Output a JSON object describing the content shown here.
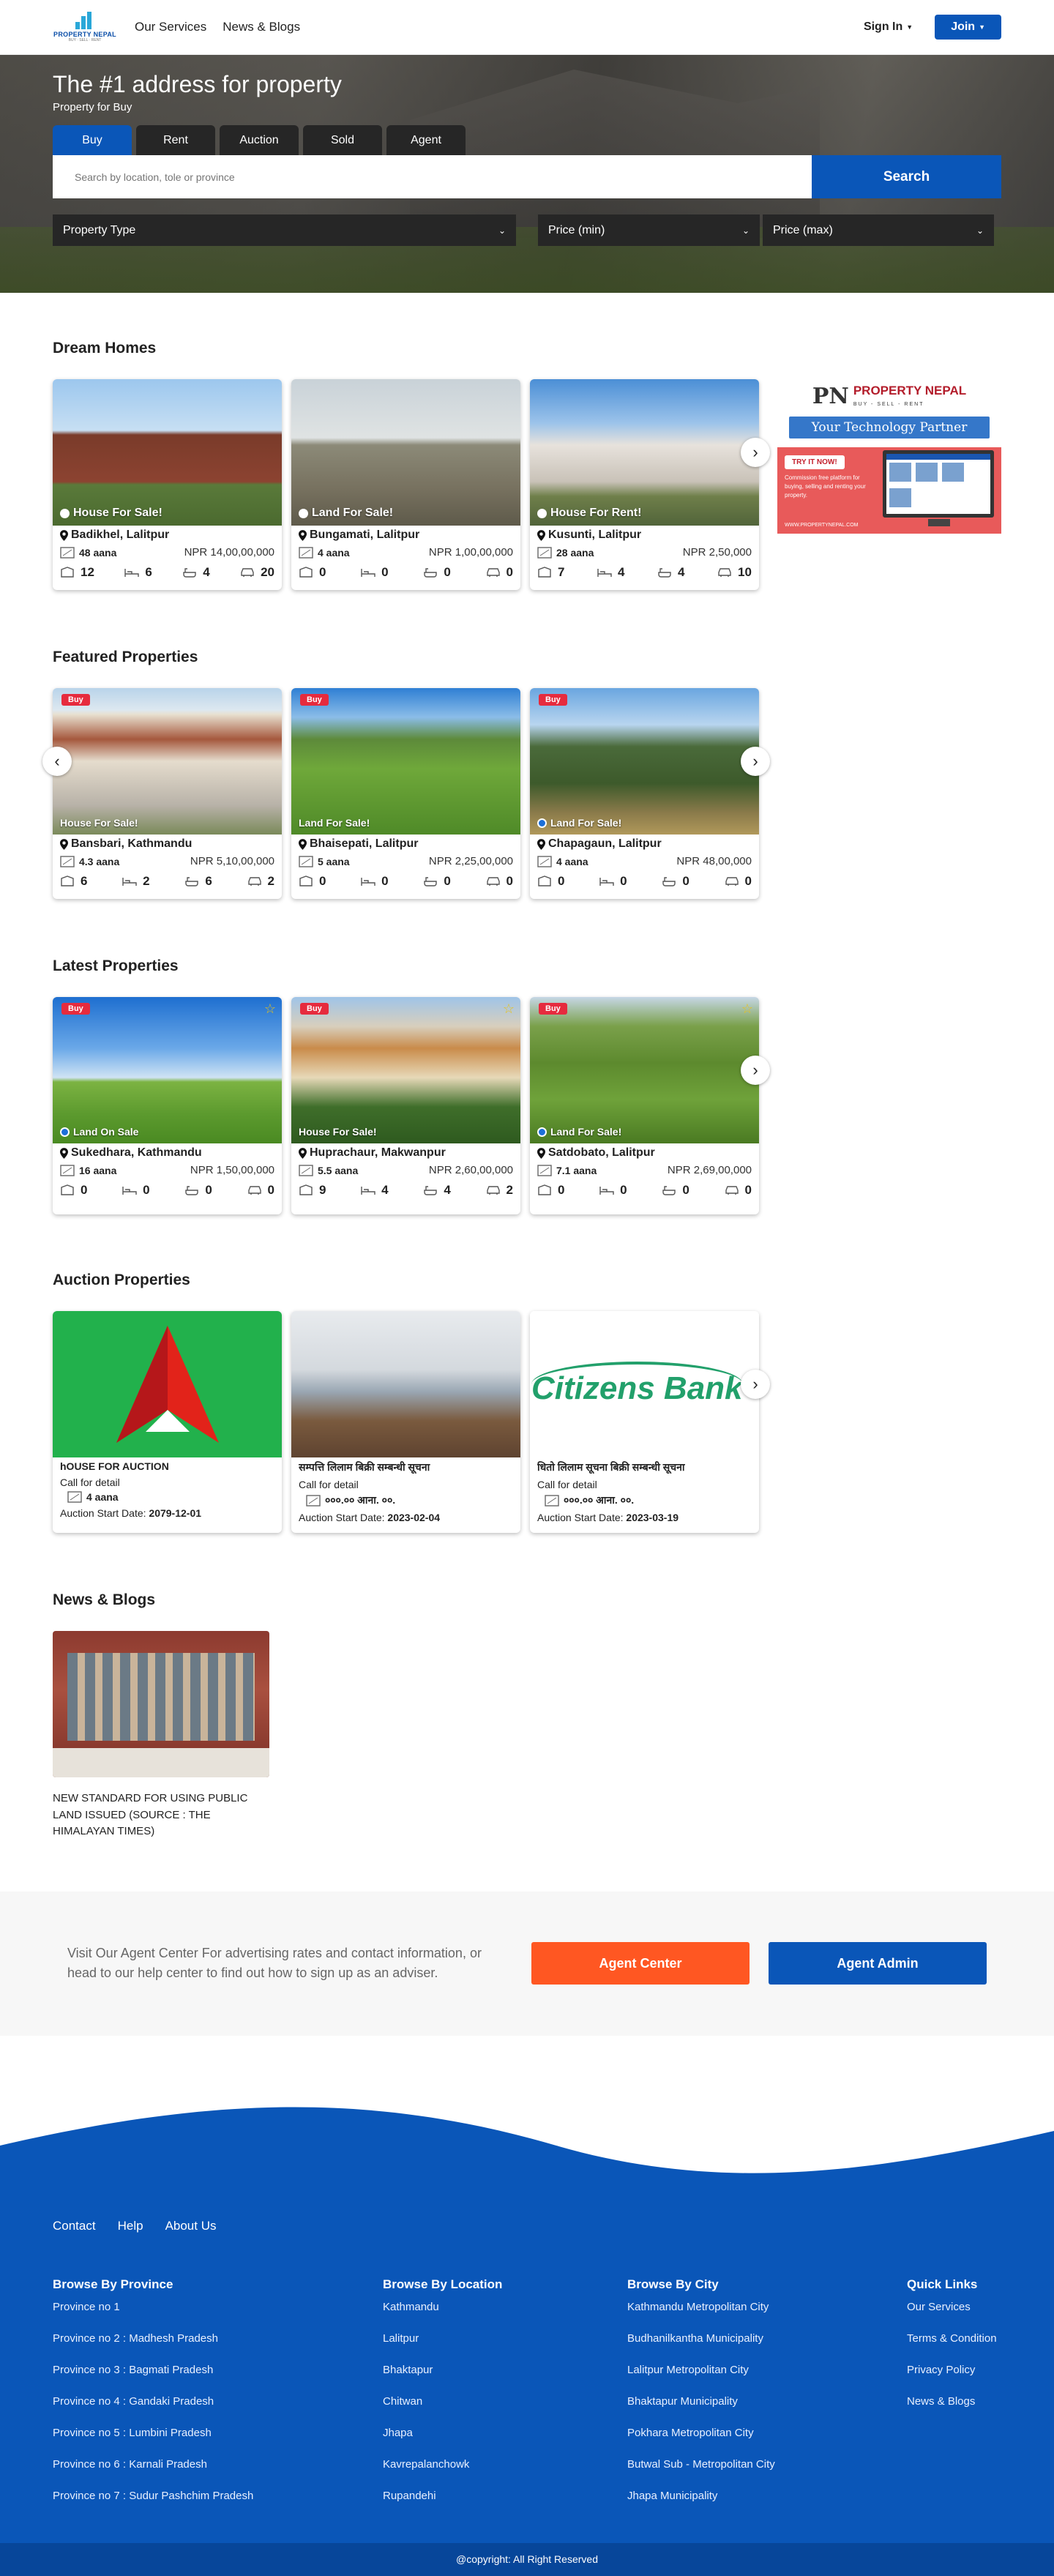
{
  "header": {
    "logo_text": "PROPERTY NEPAL",
    "logo_sub": "BUY · SELL · RENT",
    "nav": [
      "Our Services",
      "News & Blogs"
    ],
    "signin": "Sign In",
    "join": "Join"
  },
  "hero": {
    "title": "The #1 address for property",
    "subtitle": "Property for Buy",
    "tabs": [
      "Buy",
      "Rent",
      "Auction",
      "Sold",
      "Agent"
    ],
    "active_tab": "Buy",
    "search_placeholder": "Search by location, tole or province",
    "search_button": "Search",
    "filter_type": "Property Type",
    "filter_min": "Price (min)",
    "filter_max": "Price (max)"
  },
  "dream": {
    "title": "Dream Homes",
    "cards": [
      {
        "label": "House For Sale!",
        "location": "Badikhel, Lalitpur",
        "area": "48 aana",
        "price": "NPR 14,00,00,000",
        "stats": [
          "12",
          "6",
          "4",
          "20"
        ]
      },
      {
        "label": "Land For Sale!",
        "location": "Bungamati, Lalitpur",
        "area": "4 aana",
        "price": "NPR 1,00,00,000",
        "stats": [
          "0",
          "0",
          "0",
          "0"
        ]
      },
      {
        "label": "House For Rent!",
        "location": "Kusunti, Lalitpur",
        "area": "28 aana",
        "price": "NPR 2,50,000",
        "stats": [
          "7",
          "4",
          "4",
          "10"
        ]
      }
    ]
  },
  "ad": {
    "brand": "PROPERTY NEPAL",
    "brand_sub": "BUY - SELL - RENT",
    "pill": "Your Technology Partner",
    "try": "TRY IT NOW!",
    "copy": "Commission free platform for buying, selling and renting your property.",
    "url": "WWW.PROPERTYNEPAL.COM"
  },
  "featured": {
    "title": "Featured Properties",
    "cards": [
      {
        "tag": "Buy",
        "label": "House For Sale!",
        "location": "Bansbari, Kathmandu",
        "area": "4.3 aana",
        "price": "NPR 5,10,00,000",
        "stats": [
          "6",
          "2",
          "6",
          "2"
        ]
      },
      {
        "tag": "Buy",
        "label": "Land For Sale!",
        "location": "Bhaisepati, Lalitpur",
        "area": "5 aana",
        "price": "NPR 2,25,00,000",
        "stats": [
          "0",
          "0",
          "0",
          "0"
        ]
      },
      {
        "tag": "Buy",
        "label": "Land For Sale!",
        "location": "Chapagaun, Lalitpur",
        "area": "4 aana",
        "price": "NPR 48,00,000",
        "stats": [
          "0",
          "0",
          "0",
          "0"
        ]
      }
    ]
  },
  "latest": {
    "title": "Latest Properties",
    "cards": [
      {
        "tag": "Buy",
        "label": "Land On Sale",
        "location": "Sukedhara, Kathmandu",
        "area": "16 aana",
        "price": "NPR 1,50,00,000",
        "stats": [
          "0",
          "0",
          "0",
          "0"
        ]
      },
      {
        "tag": "Buy",
        "label": "House For Sale!",
        "location": "Huprachaur, Makwanpur",
        "area": "5.5 aana",
        "price": "NPR 2,60,00,000",
        "stats": [
          "9",
          "4",
          "4",
          "2"
        ]
      },
      {
        "tag": "Buy",
        "label": "Land For Sale!",
        "location": "Satdobato, Lalitpur",
        "area": "7.1 aana",
        "price": "NPR 2,69,00,000",
        "stats": [
          "0",
          "0",
          "0",
          "0"
        ]
      }
    ]
  },
  "auction": {
    "title": "Auction Properties",
    "cards": [
      {
        "title": "hOUSE FOR AUCTION",
        "call": "Call for detail",
        "area": "4 aana",
        "date_label": "Auction Start Date:",
        "date": "2079-12-01"
      },
      {
        "title": "सम्पत्ति लिलाम बिक्री सम्बन्धी सूचना",
        "call": "Call for detail",
        "area": "०००.०० आना. ००.",
        "date_label": "Auction Start Date:",
        "date": "2023-02-04"
      },
      {
        "title": "धितो लिलाम सूचना बिक्री सम्बन्धी सूचना",
        "call": "Call for detail",
        "area": "०००.०० आना. ००.",
        "date_label": "Auction Start Date:",
        "date": "2023-03-19",
        "logo": "Citizens Bank"
      }
    ]
  },
  "news": {
    "title": "News & Blogs",
    "items": [
      {
        "title": "NEW STANDARD FOR USING PUBLIC LAND ISSUED (SOURCE : THE HIMALAYAN TIMES)"
      }
    ]
  },
  "agent": {
    "text": "Visit Our Agent Center For advertising rates and contact information, or head to our help center to find out how to sign up as an adviser.",
    "center": "Agent Center",
    "admin": "Agent Admin"
  },
  "footer": {
    "links": [
      "Contact",
      "Help",
      "About Us"
    ],
    "cols": [
      {
        "title": "Browse By Province",
        "items": [
          "Province no 1",
          "Province no 2 : Madhesh Pradesh",
          "Province no 3 : Bagmati Pradesh",
          "Province no 4 : Gandaki Pradesh",
          "Province no 5 : Lumbini Pradesh",
          "Province no 6 : Karnali Pradesh",
          "Province no 7 : Sudur Pashchim Pradesh"
        ]
      },
      {
        "title": "Browse By Location",
        "items": [
          "Kathmandu",
          "Lalitpur",
          "Bhaktapur",
          "Chitwan",
          "Jhapa",
          "Kavrepalanchowk",
          "Rupandehi"
        ]
      },
      {
        "title": "Browse By City",
        "items": [
          "Kathmandu Metropolitan City",
          "Budhanilkantha Municipality",
          "Lalitpur Metropolitan City",
          "Bhaktapur Municipality",
          "Pokhara Metropolitan City",
          "Butwal Sub - Metropolitan City",
          "Jhapa Municipality"
        ]
      },
      {
        "title": "Quick Links",
        "items": [
          "Our Services",
          "Terms & Condition",
          "Privacy Policy",
          "News & Blogs"
        ]
      }
    ],
    "copyright": "@copyright: All Right Reserved"
  },
  "colors": {
    "primary": "#0a56b8",
    "accent": "#ff5722",
    "tag": "#e62b3e"
  }
}
